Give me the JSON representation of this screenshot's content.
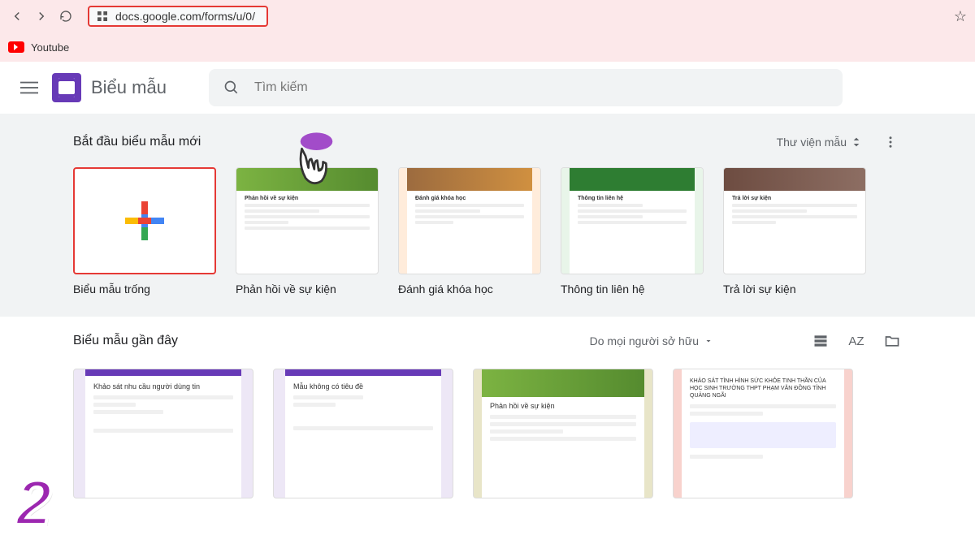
{
  "browser": {
    "url": "docs.google.com/forms/u/0/",
    "bookmark": "Youtube"
  },
  "header": {
    "app_title": "Biểu mẫu",
    "search_placeholder": "Tìm kiếm"
  },
  "templates": {
    "section_title": "Bắt đầu biểu mẫu mới",
    "gallery_label": "Thư viện mẫu",
    "items": [
      {
        "label": "Biểu mẫu trống"
      },
      {
        "label": "Phản hồi về sự kiện",
        "mini_title": "Phản hồi về sự kiện"
      },
      {
        "label": "Đánh giá khóa học",
        "mini_title": "Đánh giá khóa học"
      },
      {
        "label": "Thông tin liên hệ",
        "mini_title": "Thông tin liên hệ"
      },
      {
        "label": "Trả lời sự kiện",
        "mini_title": "Trả lời sự kiện"
      }
    ]
  },
  "recent": {
    "section_title": "Biểu mẫu gần đây",
    "owner_filter": "Do mọi người sở hữu",
    "items": [
      {
        "title": "Khảo sát nhu cầu người dùng tin"
      },
      {
        "title": "Mẫu không có tiêu đề"
      },
      {
        "title": "Phản hồi về sự kiện"
      },
      {
        "title": "KHẢO SÁT TÌNH HÌNH SỨC KHỎE TINH THẦN CỦA HỌC SINH TRƯỜNG THPT PHẠM VĂN ĐỒNG TỈNH QUẢNG NGÃI"
      }
    ]
  },
  "annotation": {
    "step_number": "2"
  }
}
